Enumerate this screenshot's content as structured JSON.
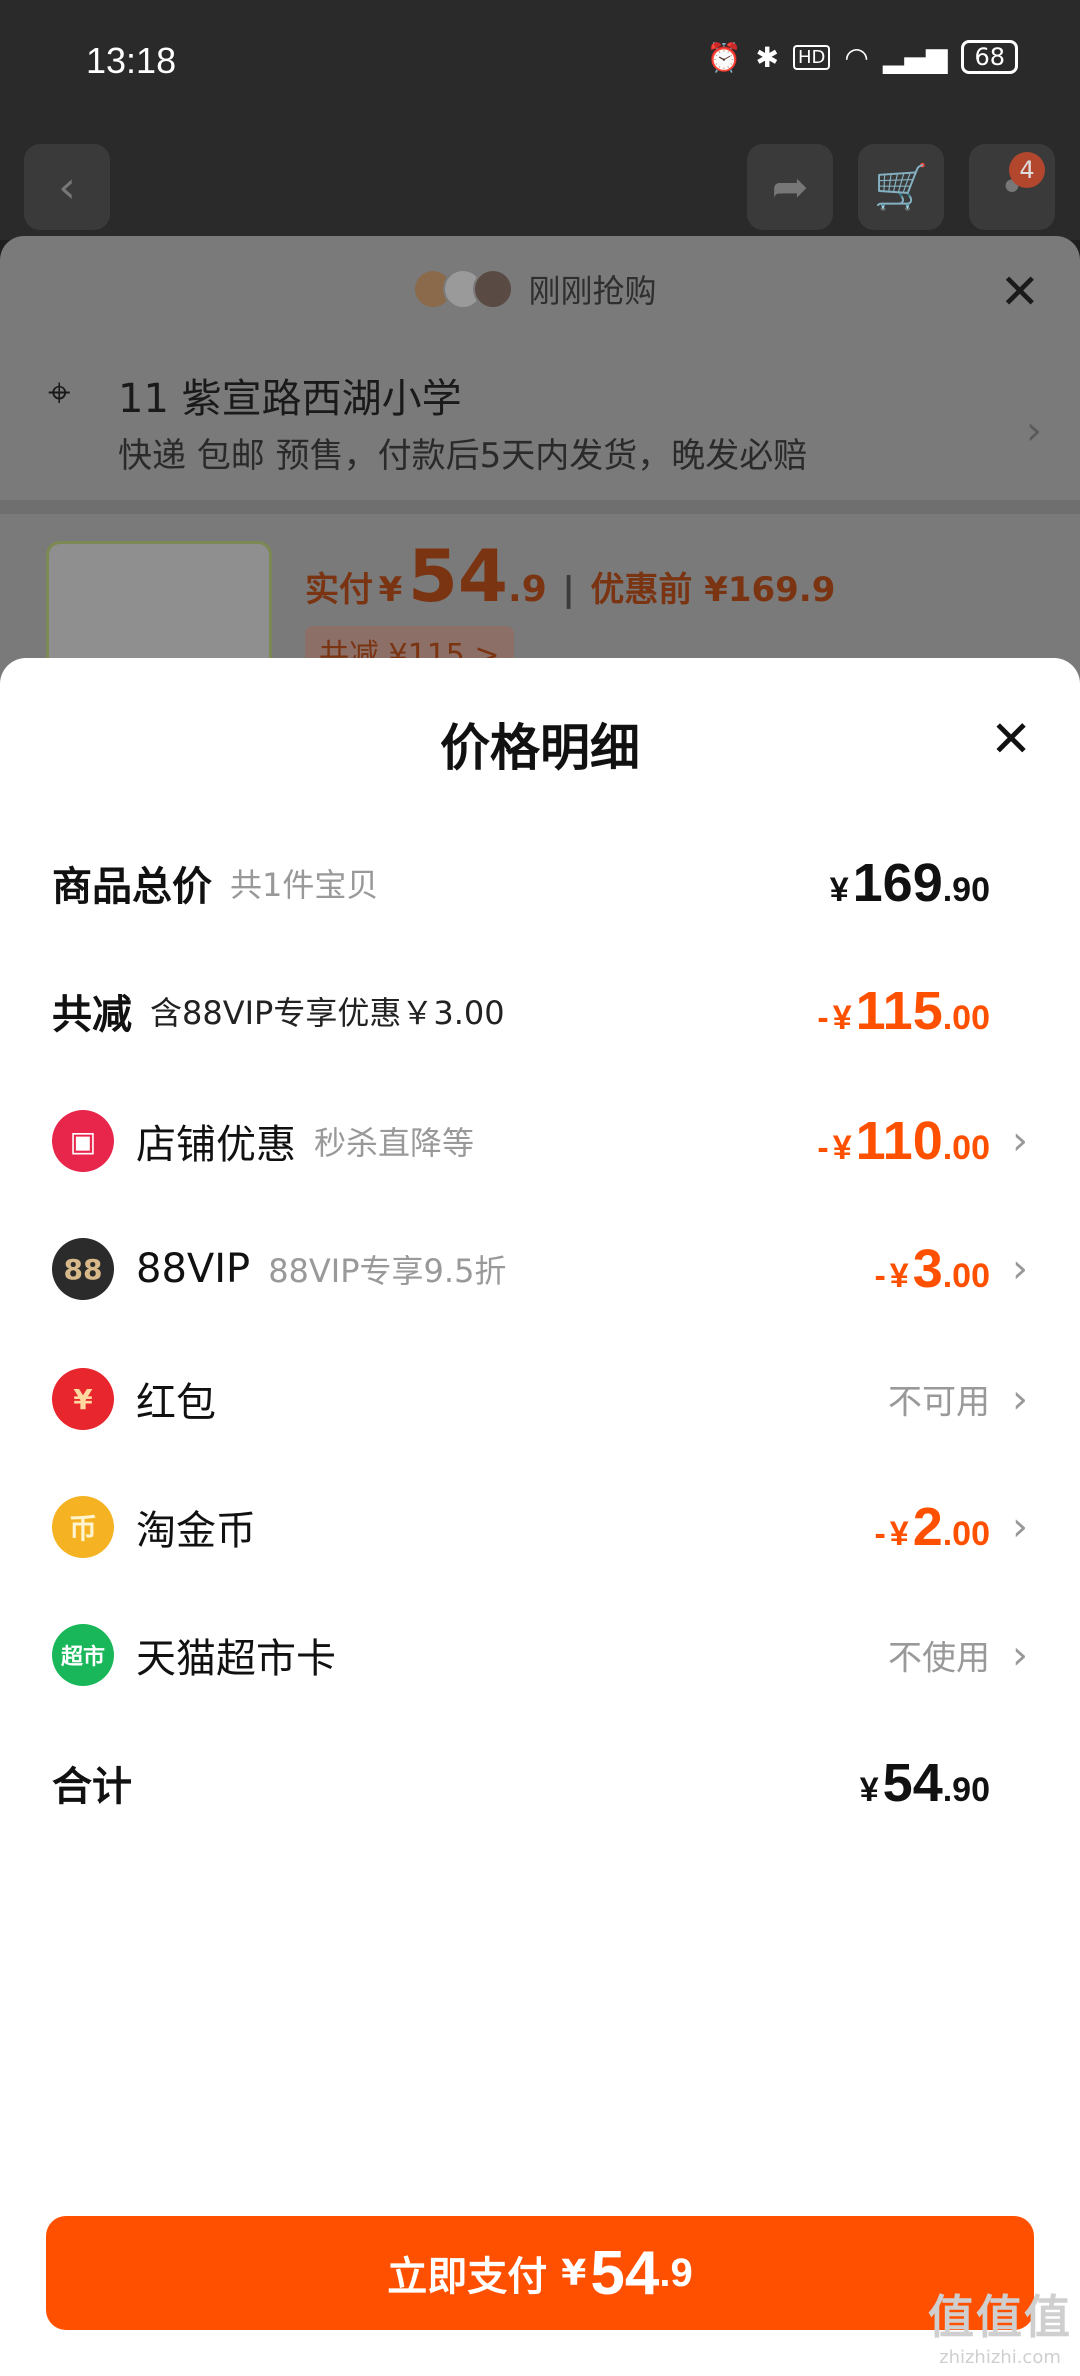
{
  "status_bar": {
    "time": "13:18",
    "battery": "68"
  },
  "nav": {
    "cart_badge": "4"
  },
  "background": {
    "grab_text": "刚刚抢购",
    "address_title": "11 紫宣路西湖小学",
    "address_sub": "快递 包邮 预售，付款后5天内发货，晚发必赔",
    "price_label": "实付",
    "price_currency": "¥",
    "price_int": "54",
    "price_dec": ".9",
    "price_before": "优惠前 ¥169.9",
    "save_text": "共减 ¥115 >"
  },
  "modal": {
    "title": "价格明细",
    "rows": [
      {
        "label": "商品总价",
        "sub": "共1件宝贝",
        "sign": "",
        "cur": "¥",
        "int": "169",
        "dec": ".90",
        "icon": ""
      },
      {
        "label": "共减",
        "sub": "含88VIP专享优惠￥3.00",
        "sign": "- ",
        "cur": "¥",
        "int": "115",
        "dec": ".00",
        "icon": ""
      },
      {
        "label": "店铺优惠",
        "sub": "秒杀直降等",
        "sign": "- ",
        "cur": "¥",
        "int": "110",
        "dec": ".00",
        "icon": "store-icon"
      },
      {
        "label": "88VIP",
        "sub": "88VIP专享9.5折",
        "sign": "- ",
        "cur": "¥",
        "int": "3",
        "dec": ".00",
        "icon": "88vip-icon",
        "icon_text": "88"
      },
      {
        "label": "红包",
        "sub": "",
        "status": "不可用",
        "icon": "red-packet-icon",
        "icon_text": "¥"
      },
      {
        "label": "淘金币",
        "sub": "",
        "sign": "- ",
        "cur": "¥",
        "int": "2",
        "dec": ".00",
        "icon": "gold-coin-icon",
        "icon_text": "币"
      },
      {
        "label": "天猫超市卡",
        "sub": "",
        "status": "不使用",
        "icon": "tmall-supermarket-card-icon",
        "icon_text": "超市"
      },
      {
        "label": "合计",
        "sub": "",
        "sign": "",
        "cur": "¥",
        "int": "54",
        "dec": ".90",
        "icon": ""
      }
    ],
    "pay_button": {
      "label": "立即支付",
      "cur": "¥",
      "int": "54",
      "dec": ".9"
    }
  },
  "watermark": {
    "logo": "值值值",
    "site": "zhizhizhi.com"
  },
  "colors": {
    "accent": "#ff5000",
    "store_icon": "#e8264b",
    "vip_icon": "#2b2b2b",
    "red_packet_icon": "#e8262e",
    "coin_icon": "#f5b323",
    "tmall_card_icon": "#19b75a"
  }
}
